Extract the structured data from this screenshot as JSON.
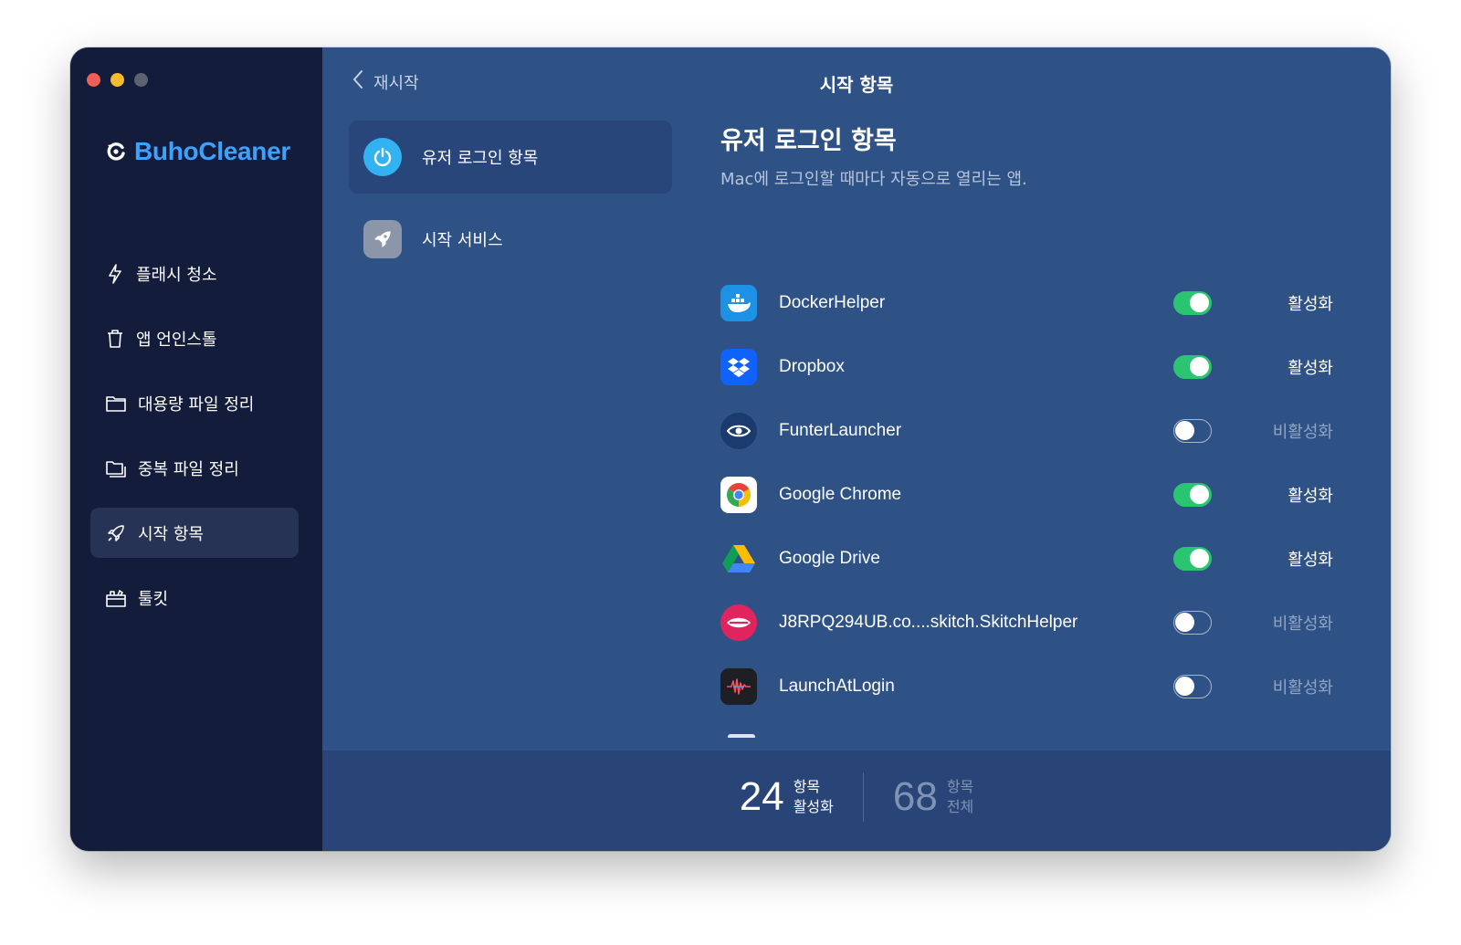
{
  "brand": {
    "name": "BuhoCleaner",
    "color": "#3da2ff"
  },
  "sidebar": {
    "items": [
      {
        "label": "플래시 청소",
        "icon": "bolt-icon",
        "active": false
      },
      {
        "label": "앱 언인스톨",
        "icon": "trash-icon",
        "active": false
      },
      {
        "label": "대용량 파일 정리",
        "icon": "folder-icon",
        "active": false
      },
      {
        "label": "중복 파일 정리",
        "icon": "duplicate-folder-icon",
        "active": false
      },
      {
        "label": "시작 항목",
        "icon": "rocket-icon",
        "active": true
      },
      {
        "label": "툴킷",
        "icon": "toolkit-icon",
        "active": false
      }
    ]
  },
  "header": {
    "back_label": "재시작",
    "title": "시작 항목"
  },
  "categories": [
    {
      "label": "유저 로그인 항목",
      "icon": "power-icon",
      "active": true
    },
    {
      "label": "시작 서비스",
      "icon": "rocket-icon",
      "active": false
    }
  ],
  "section": {
    "title": "유저 로그인 항목",
    "description": "Mac에 로그인할 때마다 자동으로 열리는 앱."
  },
  "apps": [
    {
      "name": "DockerHelper",
      "icon": "docker-icon",
      "enabled": true,
      "status": "활성화"
    },
    {
      "name": "Dropbox",
      "icon": "dropbox-icon",
      "enabled": true,
      "status": "활성화"
    },
    {
      "name": "FunterLauncher",
      "icon": "eye-icon",
      "enabled": false,
      "status": "비활성화"
    },
    {
      "name": "Google Chrome",
      "icon": "chrome-icon",
      "enabled": true,
      "status": "활성화"
    },
    {
      "name": "Google Drive",
      "icon": "google-drive-icon",
      "enabled": true,
      "status": "활성화"
    },
    {
      "name": "J8RPQ294UB.co....skitch.SkitchHelper",
      "icon": "skitch-icon",
      "enabled": false,
      "status": "비활성화"
    },
    {
      "name": "LaunchAtLogin",
      "icon": "waveform-icon",
      "enabled": false,
      "status": "비활성화"
    }
  ],
  "footer": {
    "enabled_count": "24",
    "enabled_label_top": "항목",
    "enabled_label_bottom": "활성화",
    "total_count": "68",
    "total_label_top": "항목",
    "total_label_bottom": "전체"
  },
  "colors": {
    "toggle_on": "#2bc470",
    "sidebar_bg": "#131c3b",
    "content_bg": "#2f5286"
  }
}
